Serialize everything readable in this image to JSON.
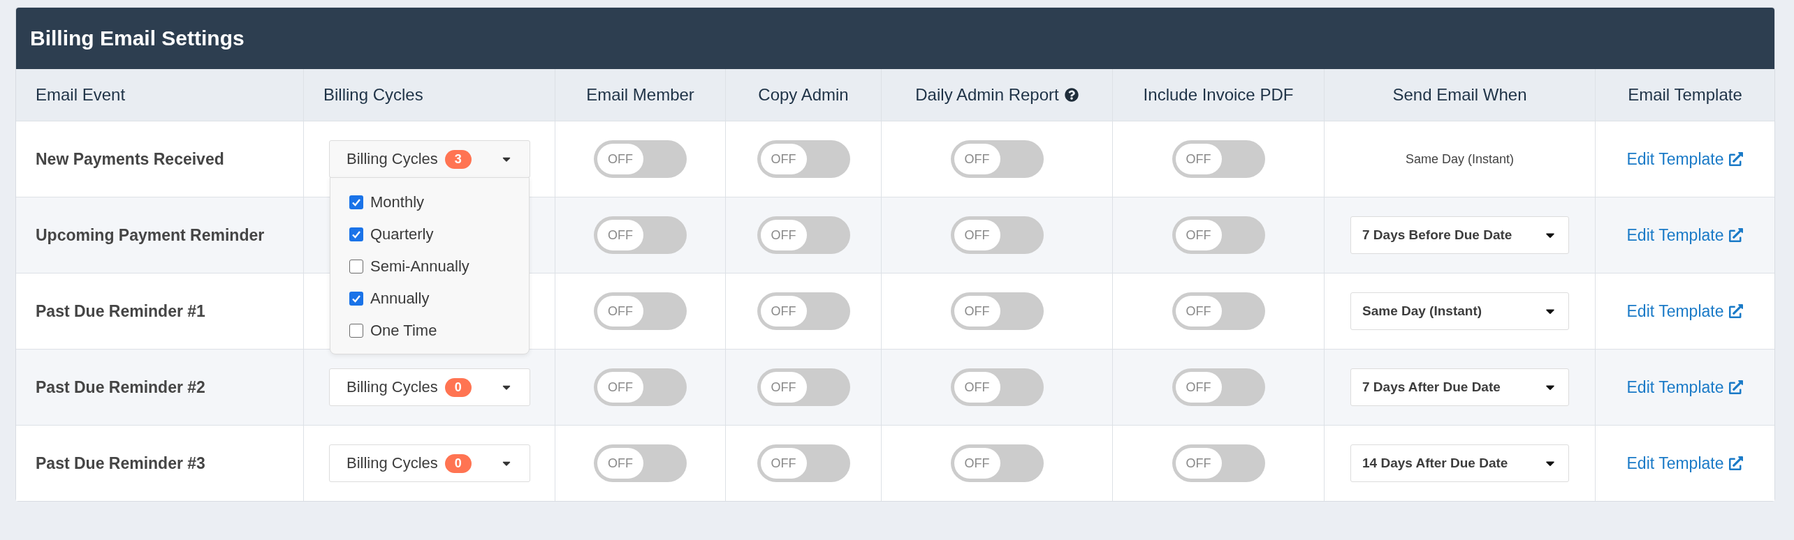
{
  "panel": {
    "title": "Billing Email Settings"
  },
  "columns": [
    {
      "label": "Email Event",
      "help": false
    },
    {
      "label": "Billing Cycles",
      "help": false
    },
    {
      "label": "Email Member",
      "help": false
    },
    {
      "label": "Copy Admin",
      "help": false
    },
    {
      "label": "Daily Admin Report",
      "help": true
    },
    {
      "label": "Include Invoice PDF",
      "help": false
    },
    {
      "label": "Send Email When",
      "help": false
    },
    {
      "label": "Email Template",
      "help": false
    }
  ],
  "rows": [
    {
      "event": "New Payments Received",
      "billing_cycles": {
        "label": "Billing Cycles",
        "count": "3",
        "expanded": true,
        "options": [
          {
            "label": "Monthly",
            "checked": true
          },
          {
            "label": "Quarterly",
            "checked": true
          },
          {
            "label": "Semi-Annually",
            "checked": false
          },
          {
            "label": "Annually",
            "checked": true
          },
          {
            "label": "One Time",
            "checked": false
          }
        ]
      },
      "toggles": [
        {
          "label": "OFF",
          "on": false
        },
        {
          "label": "OFF",
          "on": false
        },
        {
          "label": "OFF",
          "on": false
        },
        {
          "label": "OFF",
          "on": false
        }
      ],
      "send_when": {
        "kind": "text",
        "value": "Same Day (Instant)"
      },
      "template_link": "Edit Template"
    },
    {
      "event": "Upcoming Payment Reminder",
      "toggles": [
        {
          "label": "OFF",
          "on": false
        },
        {
          "label": "OFF",
          "on": false
        },
        {
          "label": "OFF",
          "on": false
        },
        {
          "label": "OFF",
          "on": false
        }
      ],
      "send_when": {
        "kind": "select",
        "value": "7 Days Before Due Date"
      },
      "template_link": "Edit Template"
    },
    {
      "event": "Past Due Reminder #1",
      "toggles": [
        {
          "label": "OFF",
          "on": false
        },
        {
          "label": "OFF",
          "on": false
        },
        {
          "label": "OFF",
          "on": false
        },
        {
          "label": "OFF",
          "on": false
        }
      ],
      "send_when": {
        "kind": "select",
        "value": "Same Day (Instant)"
      },
      "template_link": "Edit Template"
    },
    {
      "event": "Past Due Reminder #2",
      "billing_cycles": {
        "label": "Billing Cycles",
        "count": "0"
      },
      "toggles": [
        {
          "label": "OFF",
          "on": false
        },
        {
          "label": "OFF",
          "on": false
        },
        {
          "label": "OFF",
          "on": false
        },
        {
          "label": "OFF",
          "on": false
        }
      ],
      "send_when": {
        "kind": "select",
        "value": "7 Days After Due Date"
      },
      "template_link": "Edit Template"
    },
    {
      "event": "Past Due Reminder #3",
      "billing_cycles": {
        "label": "Billing Cycles",
        "count": "0"
      },
      "toggles": [
        {
          "label": "OFF",
          "on": false
        },
        {
          "label": "OFF",
          "on": false
        },
        {
          "label": "OFF",
          "on": false
        },
        {
          "label": "OFF",
          "on": false
        }
      ],
      "send_when": {
        "kind": "select",
        "value": "14 Days After Due Date"
      },
      "template_link": "Edit Template"
    }
  ]
}
